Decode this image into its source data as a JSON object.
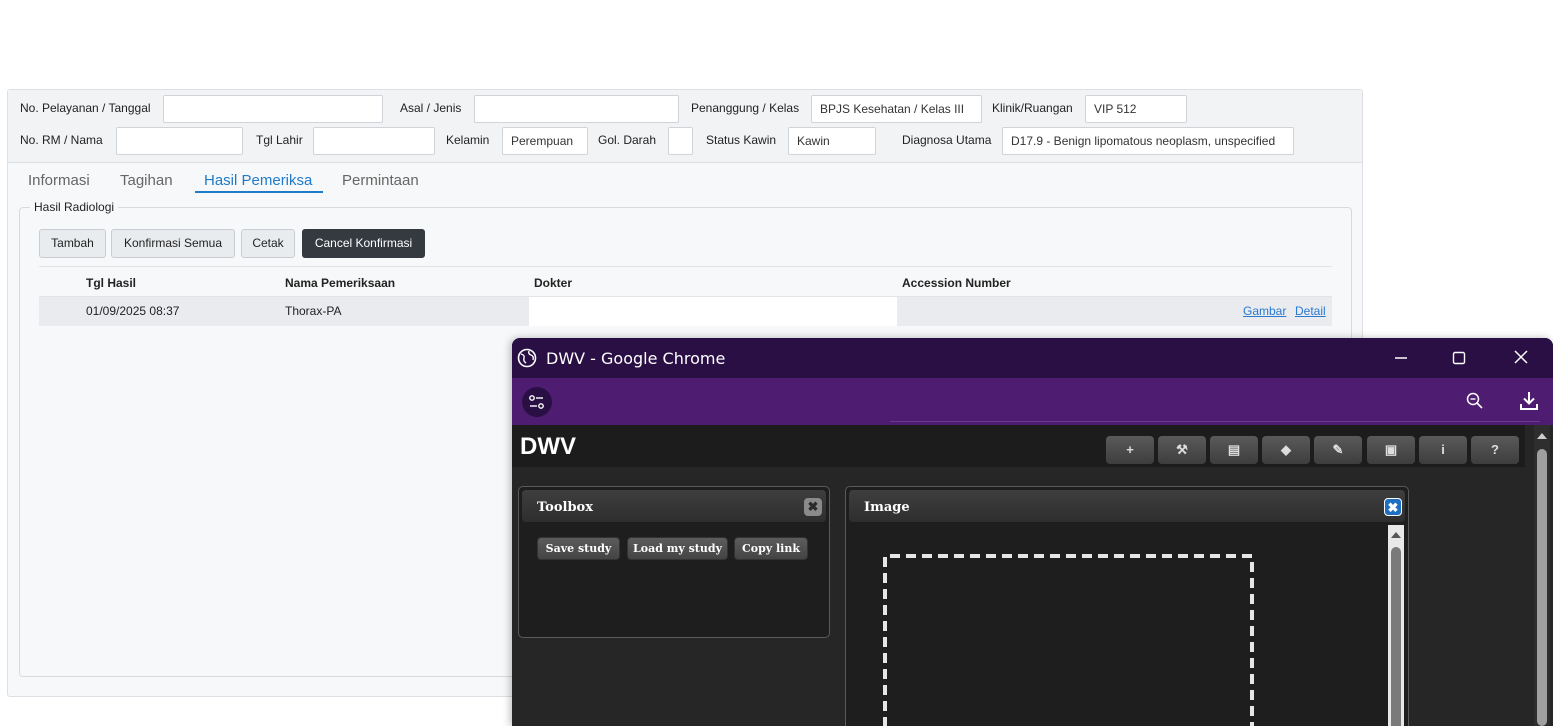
{
  "form": {
    "no_pelayanan_label": "No. Pelayanan / Tanggal",
    "no_pelayanan_value": "",
    "asal_label": "Asal / Jenis",
    "asal_value": "",
    "penanggung_label": "Penanggung / Kelas",
    "penanggung_value": "BPJS Kesehatan / Kelas III",
    "klinik_label": "Klinik/Ruangan",
    "klinik_value": "VIP 512",
    "no_rm_label": "No. RM / Nama",
    "no_rm_value": "",
    "tgl_lahir_label": "Tgl Lahir",
    "tgl_lahir_value": "",
    "kelamin_label": "Kelamin",
    "kelamin_value": "Perempuan",
    "gol_darah_label": "Gol. Darah",
    "gol_darah_value": "",
    "status_kawin_label": "Status Kawin",
    "status_kawin_value": "Kawin",
    "diagnosa_label": "Diagnosa Utama",
    "diagnosa_value": "D17.9 - Benign lipomatous neoplasm, unspecified"
  },
  "tabs": [
    "Informasi",
    "Tagihan",
    "Hasil Pemeriksa",
    "Permintaan"
  ],
  "active_tab": "Hasil Pemeriksa",
  "section": {
    "legend": "Hasil Radiologi",
    "buttons": [
      "Tambah",
      "Konfirmasi Semua",
      "Cetak",
      "Cancel Konfirmasi"
    ]
  },
  "table": {
    "headers": [
      "Tgl Hasil",
      "Nama Pemeriksaan",
      "Dokter",
      "Accession Number"
    ],
    "rows": [
      {
        "tgl": "01/09/2025 08:37",
        "nama": "Thorax-PA",
        "dokter": "",
        "accession": "",
        "links": [
          "Gambar",
          "Detail"
        ]
      }
    ]
  },
  "popup": {
    "window_title": "DWV - Google Chrome",
    "app_logo": "DWV",
    "toolbar_icons": [
      "plus-icon",
      "wrench-icon",
      "clipboard-icon",
      "tag-icon",
      "pencil-icon",
      "image-icon",
      "info-icon",
      "help-icon"
    ],
    "toolbar_glyphs": [
      "+",
      "⚒",
      "▤",
      "◆",
      "✎",
      "▣",
      "i",
      "?"
    ],
    "toolbox": {
      "title": "Toolbox",
      "buttons": [
        "Save study",
        "Load my study",
        "Copy link"
      ]
    },
    "image_panel": {
      "title": "Image"
    }
  },
  "colors": {
    "tab_active": "#1f7ac9",
    "titlebar": "#2a0f45",
    "addressbar": "#4e1d72",
    "link": "#2a7ad0"
  }
}
